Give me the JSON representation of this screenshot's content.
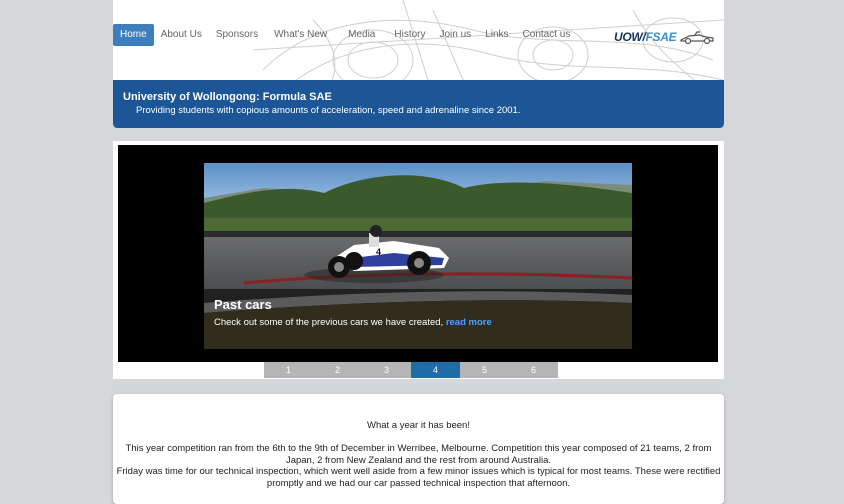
{
  "nav": {
    "items": [
      {
        "label": "Home",
        "active": true
      },
      {
        "label": "About Us"
      },
      {
        "label": "Sponsors"
      },
      {
        "label": "What's New"
      },
      {
        "label": "Media"
      },
      {
        "label": "History"
      },
      {
        "label": "Join us"
      },
      {
        "label": "Links"
      },
      {
        "label": "Contact us"
      }
    ]
  },
  "logo": {
    "part1": "UOW",
    "part2": "FSAE",
    "icon": "race-car-outline-icon"
  },
  "banner": {
    "title": "University of Wollongong: Formula SAE",
    "subtitle": "Providing students with copious amounts of acceleration, speed and adrenaline since 2001."
  },
  "slider": {
    "caption_title": "Past cars",
    "caption_text": "Check out some of the previous cars we have created,",
    "read_more": "read more",
    "pages": [
      "1",
      "2",
      "3",
      "4",
      "5",
      "6"
    ],
    "active_page": "4"
  },
  "content": {
    "heading": "What a year it has been!",
    "p1": "This year competition ran from the 6th to the 9th of December in Werribee, Melbourne. Competition this year composed of 21 teams, 2 from Japan, 2 from New Zealand and the rest from around Australia.",
    "p2": "Friday was time for our technical inspection, which went well aside from a few minor issues which is typical for most teams. These were rectified promptly and we had our car passed technical inspection that afternoon."
  },
  "colors": {
    "accent": "#3d7fbd",
    "banner": "#1c5696",
    "pager_active": "#1f6da6",
    "link": "#4aa3ff"
  }
}
